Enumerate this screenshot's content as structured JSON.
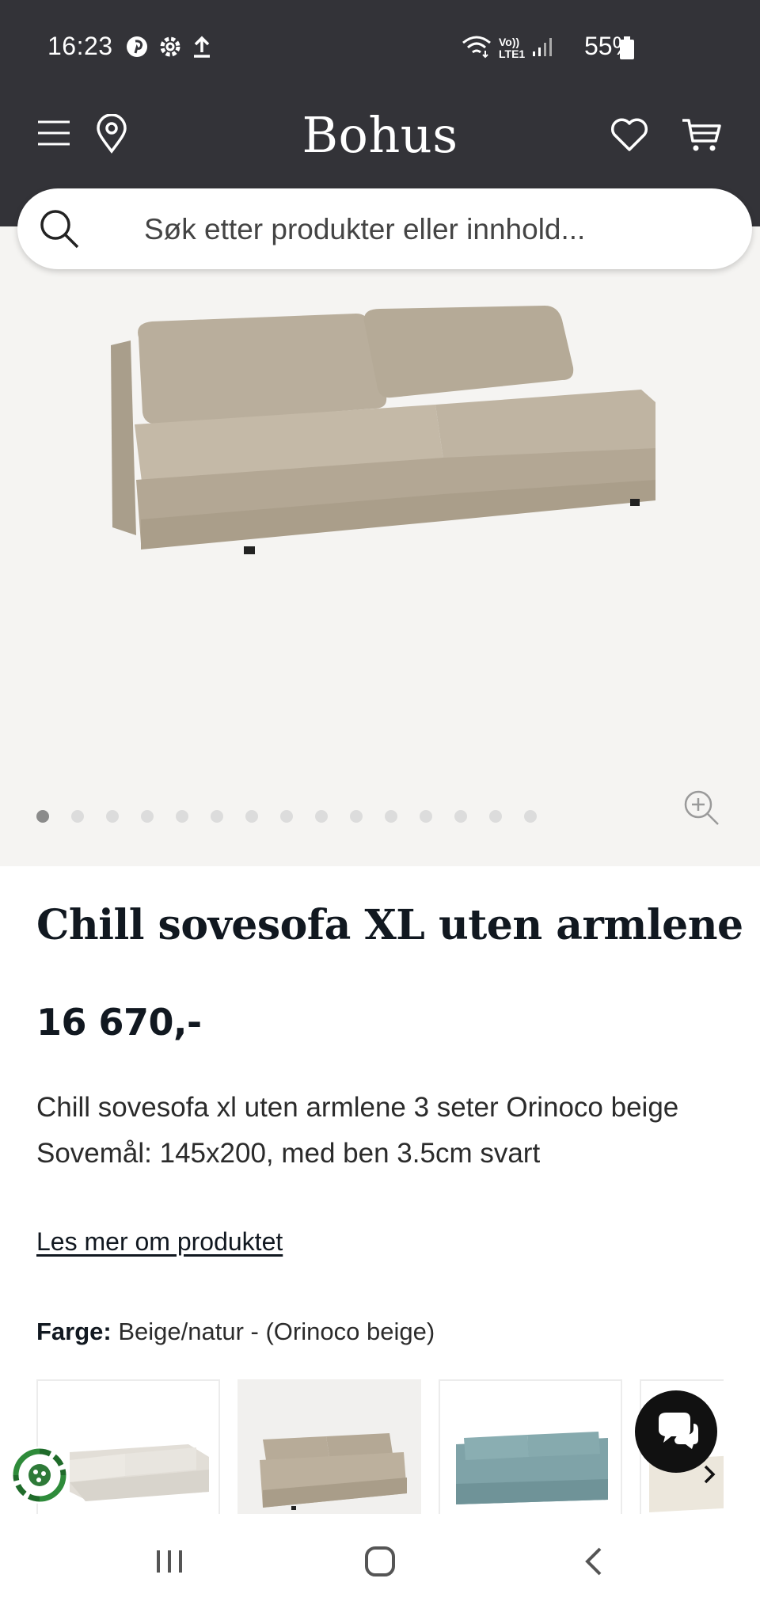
{
  "status_bar": {
    "time": "16:23",
    "left_icons": [
      "pinterest-icon",
      "settings-icon",
      "upload-icon"
    ],
    "right_icons": [
      "wifi-icon",
      "volte-icon",
      "signal-icon",
      "battery-icon"
    ],
    "network_label_top": "Vo))",
    "network_label_bottom": "LTE1",
    "battery": "55%"
  },
  "header": {
    "logo": "Bohus",
    "icons": [
      "menu-icon",
      "location-pin-icon",
      "heart-icon",
      "cart-icon"
    ]
  },
  "search": {
    "placeholder": "Søk etter produkter eller innhold..."
  },
  "gallery": {
    "dot_count": 15,
    "active_index": 0,
    "zoom_icon": "zoom-in-icon"
  },
  "product": {
    "title": "Chill sovesofa XL uten armlene",
    "price": "16 670,-",
    "description_line1": "Chill sovesofa xl uten armlene 3 seter Orinoco beige",
    "description_line2": "Sovemål: 145x200, med ben 3.5cm svart",
    "read_more": "Les mer om produktet",
    "color_label": "Farge:",
    "color_value": "Beige/natur - (Orinoco beige)"
  },
  "swatches": [
    {
      "name": "light-grey-corner-sofa",
      "color": "#e6e3dd",
      "selected": false
    },
    {
      "name": "beige-sofa",
      "color": "#b7ab98",
      "selected": true
    },
    {
      "name": "teal-sofa",
      "color": "#7fa3a8",
      "selected": false
    },
    {
      "name": "cream-sofa",
      "color": "#ece7dc",
      "selected": false
    }
  ],
  "colors": {
    "header_bg": "#333338",
    "gallery_bg": "#f5f4f2",
    "text_dark": "#111820",
    "sofa_beige": "#b9ae9c"
  }
}
